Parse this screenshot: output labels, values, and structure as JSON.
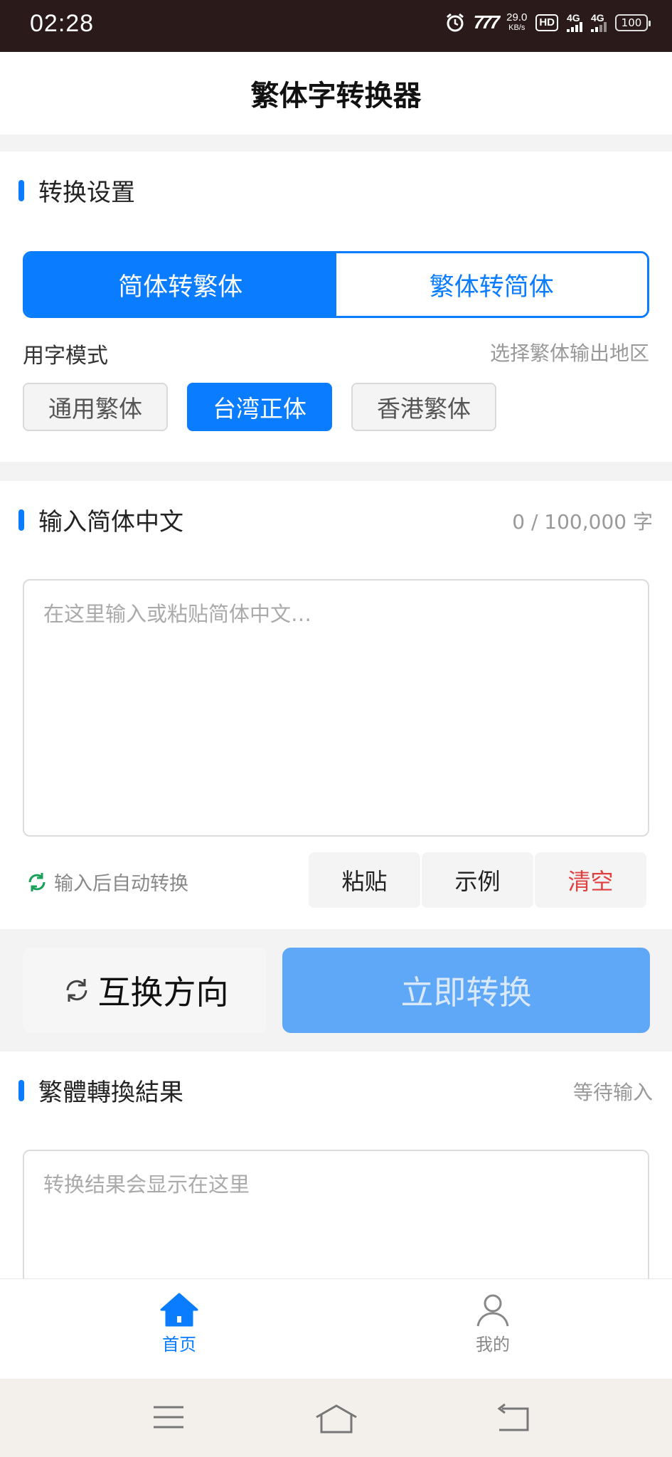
{
  "status_bar": {
    "time": "02:28",
    "net_speed_value": "29.0",
    "net_speed_unit": "KB/s",
    "hd_label": "HD",
    "sig1_label": "4G",
    "sig2_label": "4G",
    "battery": "100"
  },
  "header": {
    "title": "繁体字转换器"
  },
  "settings": {
    "title": "转换设置",
    "direction_tabs": [
      {
        "label": "简体转繁体",
        "selected": true
      },
      {
        "label": "繁体转简体",
        "selected": false
      }
    ],
    "mode_label": "用字模式",
    "mode_hint": "选择繁体输出地区",
    "modes": [
      {
        "label": "通用繁体",
        "selected": false
      },
      {
        "label": "台湾正体",
        "selected": true
      },
      {
        "label": "香港繁体",
        "selected": false
      }
    ]
  },
  "input": {
    "title": "输入简体中文",
    "counter": "0 / 100,000 字",
    "placeholder": "在这里输入或粘贴简体中文…",
    "auto_convert": "输入后自动转换",
    "paste": "粘贴",
    "example": "示例",
    "clear": "清空"
  },
  "buttons": {
    "swap": "互换方向",
    "convert": "立即转换"
  },
  "result": {
    "title": "繁體轉換結果",
    "status": "等待输入",
    "placeholder": "转换结果会显示在这里"
  },
  "tabbar": {
    "home": "首页",
    "mine": "我的"
  },
  "colors": {
    "primary": "#0a7cff",
    "convert_disabled": "#5fa8f7",
    "danger": "#e04040"
  }
}
